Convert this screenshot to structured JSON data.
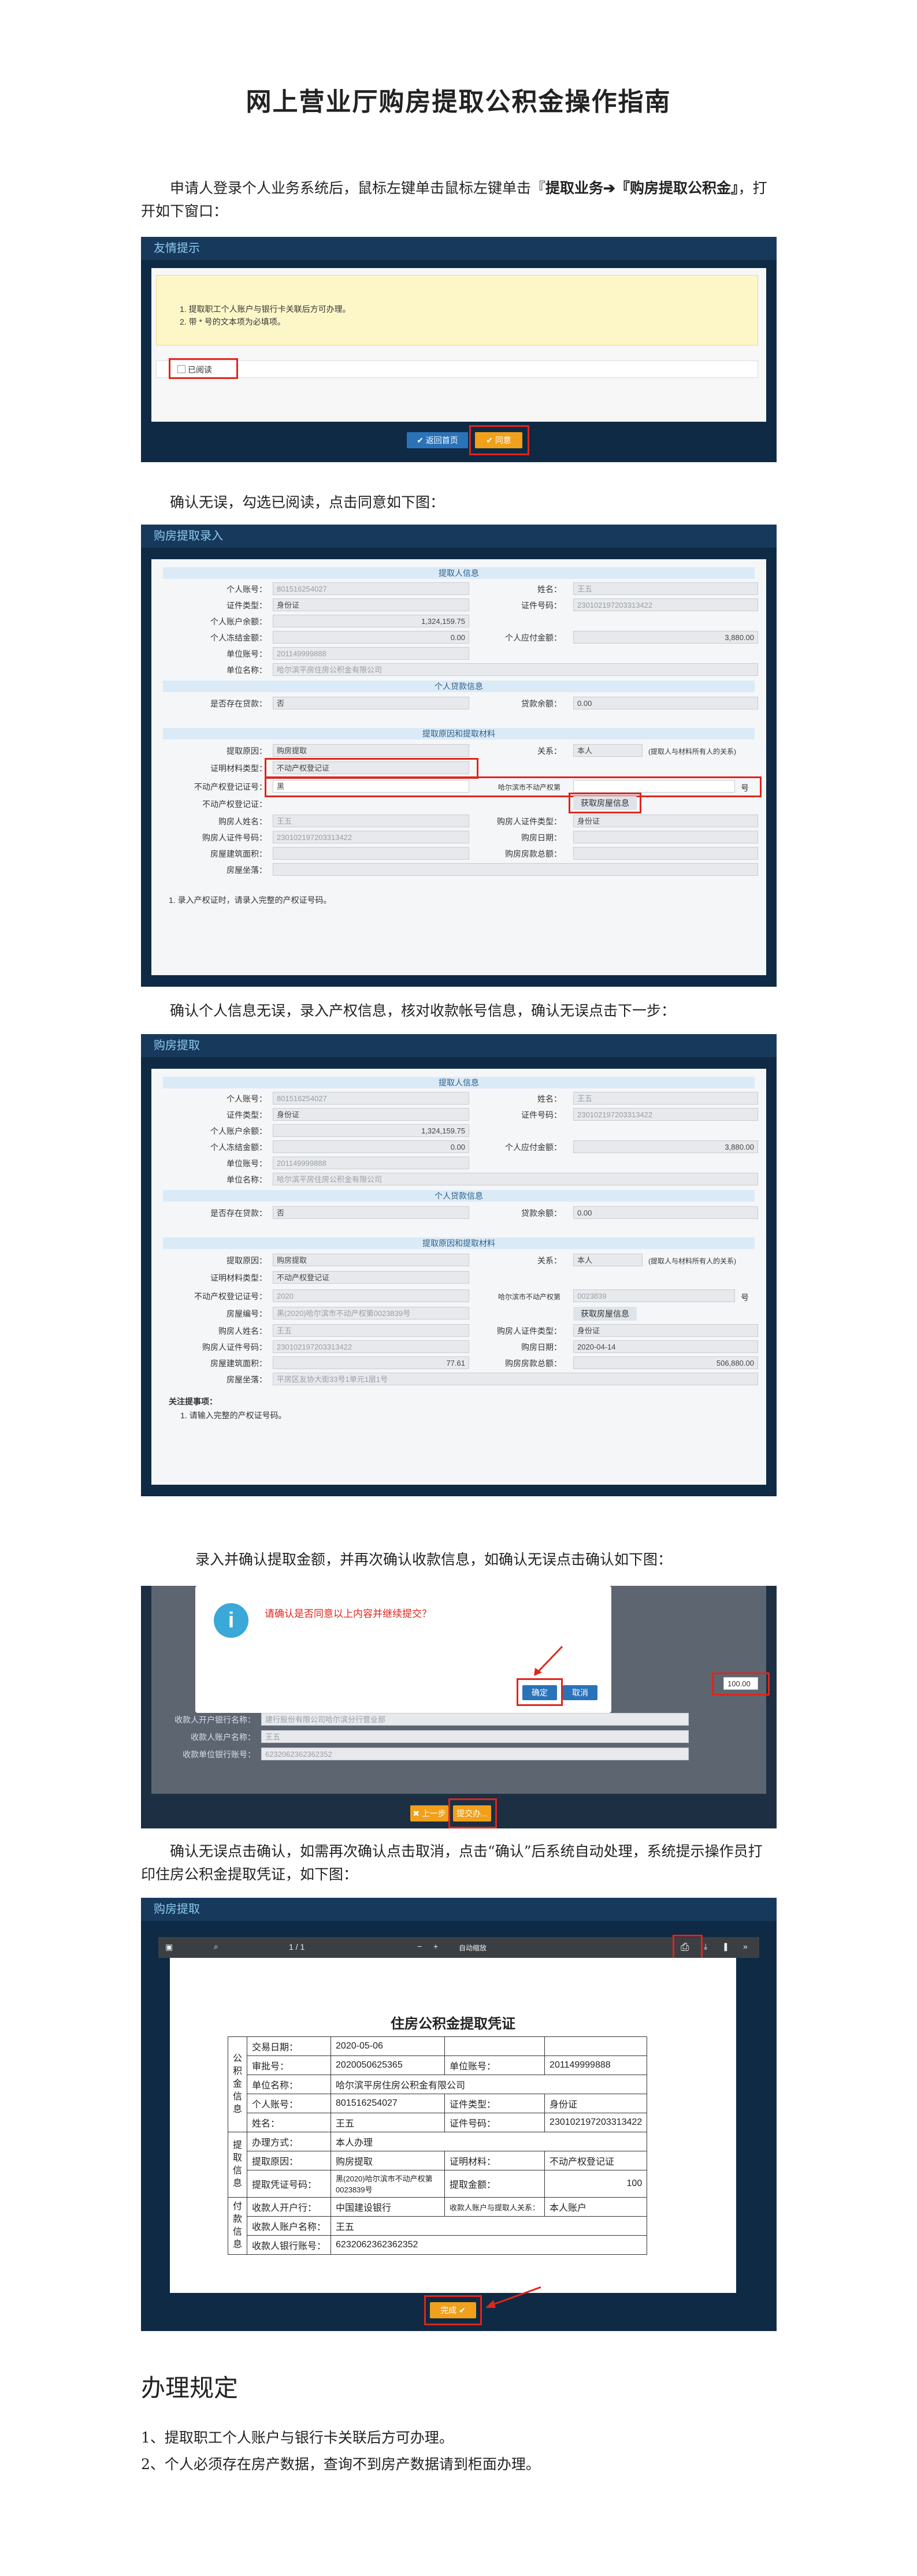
{
  "title": "网上营业厅购房提取公积金操作指南",
  "step1": {
    "text_pre": "申请人登录个人业务系统后，鼠标左键单击鼠标左键单击『",
    "bold1": "提取业务",
    "arrow": "➔",
    "bold2": "『购房提取公积金』",
    "text_post": "，打开如下窗口："
  },
  "shot1": {
    "header": "友情提示",
    "notice_line1": "1. 提取职工个人账户与银行卡关联后方可办理。",
    "notice_line2": "2. 带 * 号的文本项为必填项。",
    "read_label": "已阅读",
    "back_button": "返回首页",
    "agree_button": "同意"
  },
  "step2": {
    "text": "确认无误，勾选已阅读，点击同意如下图："
  },
  "shot2": {
    "header": "购房提取录入",
    "section_person": "提取人信息",
    "account_label": "个人账号：",
    "account_value": "801516254027",
    "name_label": "姓名：",
    "name_value": "王五",
    "idtype_label": "证件类型：",
    "idtype_value": "身份证",
    "idno_label": "证件号码：",
    "idno_value": "230102197203313422",
    "balance_label": "个人账户余额：",
    "balance_value": "1,324,159.75",
    "frozen_label": "个人冻结金额：",
    "frozen_value": "0.00",
    "payable_label": "个人应付金额：",
    "payable_value": "3,880.00",
    "unitno_label": "单位账号：",
    "unitno_value": "201149999888",
    "unitname_label": "单位名称：",
    "unitname_value": "哈尔滨平房住房公积金有限公司",
    "section_loan": "个人贷款信息",
    "hasloan_label": "是否存在贷款：",
    "hasloan_value": "否",
    "loanbal_label": "贷款余额：",
    "loanbal_value": "0.00",
    "section_reason": "提取原因和提取材料",
    "reason_label": "提取原因：",
    "reason_value": "购房提取",
    "relation_label": "关系：",
    "relation_value": "本人",
    "relation_note": "(提取人与材料所有人的关系)",
    "material_label": "证明材料类型：",
    "material_value": "不动产权登记证",
    "certno_label": "不动产权登记证号：",
    "certno_value": "黑",
    "certno_mid": "哈尔滨市不动产权第",
    "certno_suffix": "号",
    "certdate_label": "不动产权登记证：",
    "fetch_button": "获取房屋信息",
    "buyer_label": "购房人姓名：",
    "buyer_value": "王五",
    "buyer_idtype_label": "购房人证件类型：",
    "buyer_idtype_value": "身份证",
    "buyer_idno_label": "购房人证件号码：",
    "buyer_idno_value": "230102197203313422",
    "buydate_label": "购房日期：",
    "area_label": "房屋建筑面积：",
    "amount_label": "购房房款总额：",
    "address_label": "房屋坐落：",
    "note": "1. 录入产权证时，请录入完整的产权证号码。"
  },
  "step3": {
    "text": "确认个人信息无误，录入产权信息，核对收款帐号信息，确认无误点击下一步："
  },
  "shot3": {
    "header": "购房提取",
    "certno_value": "2020",
    "certno_number": "0023839",
    "houseno_label": "房屋编号：",
    "houseno_value": "黑(2020)哈尔滨市不动产权第0023839号",
    "buydate_value": "2020-04-14",
    "area_value": "77.61",
    "amount_value": "506,880.00",
    "address_value": "平房区友协大街33号1单元1层1号",
    "notes_title": "关注提事项：",
    "note": "1. 请输入完整的产权证号码。"
  },
  "step4": {
    "text": "录入并确认提取金额，并再次确认收款信息，如确认无误点击确认如下图："
  },
  "shot4": {
    "dialog_message": "请确认是否同意以上内容并继续提交？",
    "ok_button": "确定",
    "cancel_button": "取消",
    "withdraw_amount": "100.00",
    "bank_label": "收款人开户银行名称：",
    "bank_value": "建行股份有限公司哈尔滨分行营业部",
    "payee_label": "收款人账户名称：",
    "payee_value": "王五",
    "payee_no_label": "收款单位银行账号：",
    "payee_no_value": "6232062362362352",
    "back_button": "上一步",
    "submit_button": "提交办..."
  },
  "step5": {
    "text": "确认无误点击确认，如需再次确认点击取消，点击“确认”后系统自动处理，系统提示操作员打印住房公积金提取凭证，如下图："
  },
  "shot5": {
    "header": "购房提取",
    "page_indicator": "1 / 1",
    "zoom": "自动缩放",
    "print_label": "打印",
    "slip_title": "住房公积金提取凭证",
    "side_label_1": "公积金信息",
    "side_label_2": "提取信息",
    "side_label_3": "付款信息",
    "rows": [
      [
        "交易日期：",
        "2020-05-06",
        "",
        ""
      ],
      [
        "审批号：",
        "2020050625365",
        "单位账号：",
        "201149999888"
      ],
      [
        "单位名称：",
        "哈尔滨平房住房公积金有限公司",
        "",
        ""
      ],
      [
        "个人账号：",
        "801516254027",
        "证件类型：",
        "身份证"
      ],
      [
        "姓名：",
        "王五",
        "证件号码：",
        "230102197203313422"
      ],
      [
        "办理方式：",
        "本人办理",
        "",
        ""
      ],
      [
        "提取原因：",
        "购房提取",
        "证明材料：",
        "不动产权登记证"
      ],
      [
        "提取凭证号码：",
        "黑(2020)哈尔滨市不动产权第0023839号",
        "提取金额：",
        "100"
      ],
      [
        "收款人开户行：",
        "中国建设银行",
        "收款人账户与提取人关系：",
        "本人账户"
      ],
      [
        "收款人账户名称：",
        "王五",
        "",
        ""
      ],
      [
        "收款人银行账号：",
        "6232062362362352",
        "",
        ""
      ]
    ],
    "done_button": "完成"
  },
  "rules": {
    "title": "办理规定",
    "item1": "1、提取职工个人账户与银行卡关联后方可办理。",
    "item2": "2、个人必须存在房产数据，查询不到房产数据请到柜面办理。"
  }
}
